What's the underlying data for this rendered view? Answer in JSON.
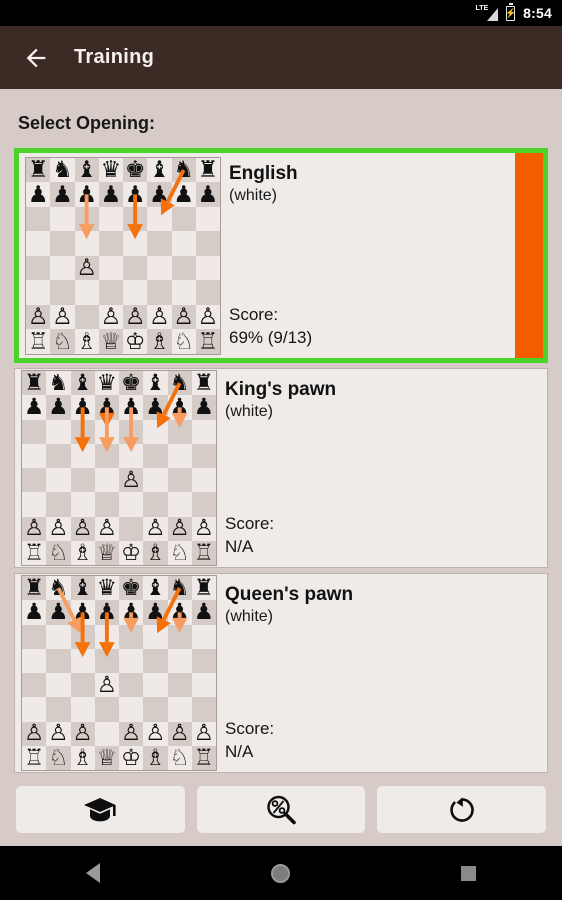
{
  "statusbar": {
    "network_label": "LTE",
    "time": "8:54",
    "signal_icon": "signal-triangle-icon",
    "battery_icon": "battery-charging-icon"
  },
  "appbar": {
    "back_icon": "back-arrow-icon",
    "title": "Training"
  },
  "main": {
    "section_title": "Select Opening:",
    "score_label": "Score:",
    "openings": [
      {
        "name": "English",
        "color": "(white)",
        "score": "69% (9/13)",
        "selected": true,
        "progress_color": "#f45c00",
        "highlight_color": "#4cd32a",
        "white_pawn_square": "c4",
        "arrows": [
          {
            "from": "c7",
            "to": "c5",
            "shade": "light"
          },
          {
            "from": "e7",
            "to": "e5",
            "shade": "dark"
          },
          {
            "from": "g8",
            "to": "f6",
            "shade": "dark"
          }
        ]
      },
      {
        "name": "King's pawn",
        "color": "(white)",
        "score": "N/A",
        "selected": false,
        "white_pawn_square": "e4",
        "arrows": [
          {
            "from": "c7",
            "to": "c5",
            "shade": "dark"
          },
          {
            "from": "d7",
            "to": "d6",
            "shade": "dark"
          },
          {
            "from": "d7",
            "to": "d5",
            "shade": "light"
          },
          {
            "from": "e7",
            "to": "e5",
            "shade": "light"
          },
          {
            "from": "g8",
            "to": "f6",
            "shade": "dark"
          },
          {
            "from": "g7",
            "to": "g6",
            "shade": "light"
          }
        ]
      },
      {
        "name": "Queen's pawn",
        "color": "(white)",
        "score": "N/A",
        "selected": false,
        "white_pawn_square": "d4",
        "arrows": [
          {
            "from": "b8",
            "to": "c6",
            "shade": "light"
          },
          {
            "from": "c7",
            "to": "c5",
            "shade": "dark"
          },
          {
            "from": "d7",
            "to": "d5",
            "shade": "dark"
          },
          {
            "from": "e7",
            "to": "e6",
            "shade": "light"
          },
          {
            "from": "g8",
            "to": "f6",
            "shade": "dark"
          },
          {
            "from": "g7",
            "to": "g6",
            "shade": "light"
          }
        ]
      }
    ]
  },
  "toolbar": {
    "buttons": [
      {
        "icon": "graduation-cap-icon",
        "name": "train-button"
      },
      {
        "icon": "percent-magnifier-icon",
        "name": "statistics-button"
      },
      {
        "icon": "reload-arrow-icon",
        "name": "reset-button"
      }
    ]
  },
  "navbar": {
    "back_icon": "nav-back-icon",
    "home_icon": "nav-home-icon",
    "recents_icon": "nav-recents-icon"
  }
}
